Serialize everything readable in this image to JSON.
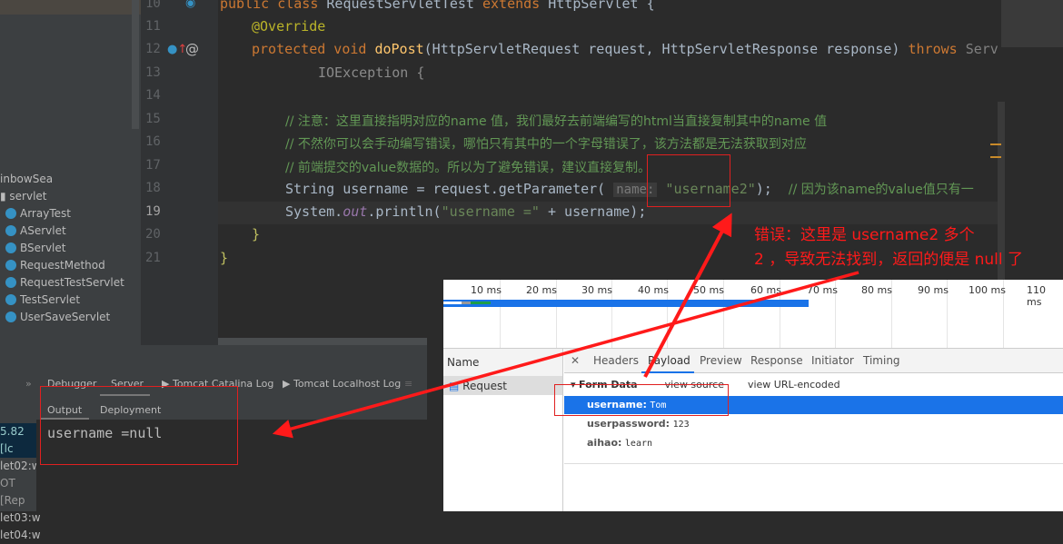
{
  "sidebar": {
    "project": "inbowSea",
    "package": "servlet",
    "classes": [
      "ArrayTest",
      "AServlet",
      "BServlet",
      "RequestMethod",
      "RequestTestServlet",
      "TestServlet",
      "UserSaveServlet"
    ]
  },
  "editor": {
    "line_numbers": [
      "10",
      "11",
      "12",
      "13",
      "14",
      "15",
      "16",
      "17",
      "18",
      "19",
      "20",
      "21"
    ],
    "l10": {
      "a": "public class ",
      "b": "RequestServletTest ",
      "c": "extends ",
      "d": "HttpServlet {"
    },
    "l11": "@Override",
    "l12": {
      "a": "protected void ",
      "b": "doPost",
      "c": "(HttpServletRequest request, HttpServletResponse response) ",
      "d": "throws ",
      "e": "Serv"
    },
    "l13": "IOException {",
    "l15": "// 注意：这里直接指明对应的name 值，我们最好去前端编写的html当直接复制其中的name 值",
    "l16": "// 不然你可以会手动编写错误，哪怕只有其中的一个字母错误了，该方法都是无法获取到对应",
    "l17": "// 前端提交的value数据的。所以为了避免错误，建议直接复制。",
    "l18": {
      "a": "String username = request.getParameter( ",
      "hint": "name:",
      "s": " \"username2\"",
      "c": ");  ",
      "cm": "// 因为该name的value值只有一"
    },
    "l19": {
      "a": "System.",
      "out": "out",
      "b": ".println(",
      "s": "\"username =\"",
      "c": " + username);"
    },
    "l20": "}",
    "l21": "}"
  },
  "bottom": {
    "tabs": [
      "Debugger",
      "Server",
      "Tomcat Catalina Log",
      "Tomcat Localhost Log"
    ],
    "subtabs": [
      "Output",
      "Deployment"
    ],
    "output": "username =null",
    "left_items": [
      "5.82 [lc",
      "let02:w",
      "OT [Rep",
      "let03:w",
      "let04:w"
    ]
  },
  "devtools": {
    "ticks": [
      "10 ms",
      "20 ms",
      "30 ms",
      "40 ms",
      "50 ms",
      "60 ms",
      "70 ms",
      "80 ms",
      "90 ms",
      "100 ms",
      "110 ms"
    ],
    "name_header": "Name",
    "request": "Request",
    "tabs": [
      "Headers",
      "Payload",
      "Preview",
      "Response",
      "Initiator",
      "Timing"
    ],
    "form_data": "Form Data",
    "view_source": "view source",
    "view_url": "view URL-encoded",
    "fields": [
      {
        "k": "username:",
        "v": "Tom"
      },
      {
        "k": "userpassword:",
        "v": "123"
      },
      {
        "k": "aihao:",
        "v": "learn"
      }
    ]
  },
  "annotation": {
    "line1": "错误：这里是 username2 多个",
    "line2": "2 ，导致无法找到，返回的便是 null 了"
  }
}
